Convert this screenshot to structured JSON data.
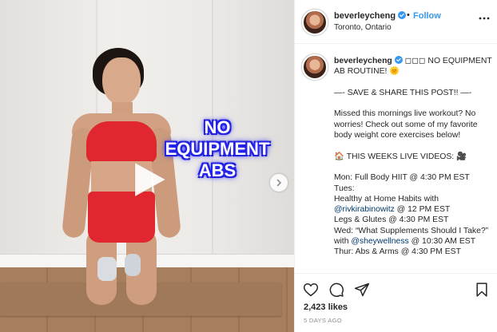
{
  "media": {
    "overlay_text": "NO EQUIPMENT ABS",
    "overlay_lines": [
      "NO",
      "EQUIPMENT",
      "ABS"
    ],
    "play_icon": "play-icon",
    "next_icon": "chevron-right-icon"
  },
  "header": {
    "username": "beverleycheng",
    "verified_icon": "verified-badge-icon",
    "separator": "•",
    "follow_label": "Follow",
    "location": "Toronto, Ontario",
    "more_icon": "more-options-icon"
  },
  "caption": {
    "username": "beverleycheng",
    "lines": [
      {
        "text": "◻◻◻ NO EQUIPMENT AB ROUTINE! 🌞"
      },
      {
        "text": ""
      },
      {
        "text": "—- SAVE & SHARE THIS POST!! —-"
      },
      {
        "text": ""
      },
      {
        "text": "Missed this mornings live workout? No worries! Check out some of my favorite body weight core exercises below!"
      },
      {
        "text": ""
      },
      {
        "text": "🏠 THIS WEEKS LIVE VIDEOS: 🎥"
      },
      {
        "text": ""
      },
      {
        "text": "Mon: Full Body HIIT @ 4:30 PM EST"
      },
      {
        "text": "Tues:"
      },
      {
        "text": "Healthy at Home Habits with"
      },
      {
        "mention": "@rivkirabinowitz",
        "text": " @ 12 PM EST"
      },
      {
        "text": "Legs & Glutes @ 4:30 PM EST"
      },
      {
        "text": "Wed: “What Supplements Should I Take?” with ",
        "mention": "@sheywellness",
        "after": " @ 10:30 AM EST"
      },
      {
        "text": "Thur: Abs & Arms @ 4:30 PM EST"
      }
    ]
  },
  "actions": {
    "like_icon": "heart-icon",
    "comment_icon": "comment-icon",
    "share_icon": "share-icon",
    "save_icon": "bookmark-icon",
    "likes": "2,423 likes",
    "timestamp": "5 DAYS AGO"
  },
  "colors": {
    "accent": "#3897f0",
    "mention": "#00376b",
    "overlay_glow": "#1f1fff",
    "outfit": "#e0262e"
  }
}
